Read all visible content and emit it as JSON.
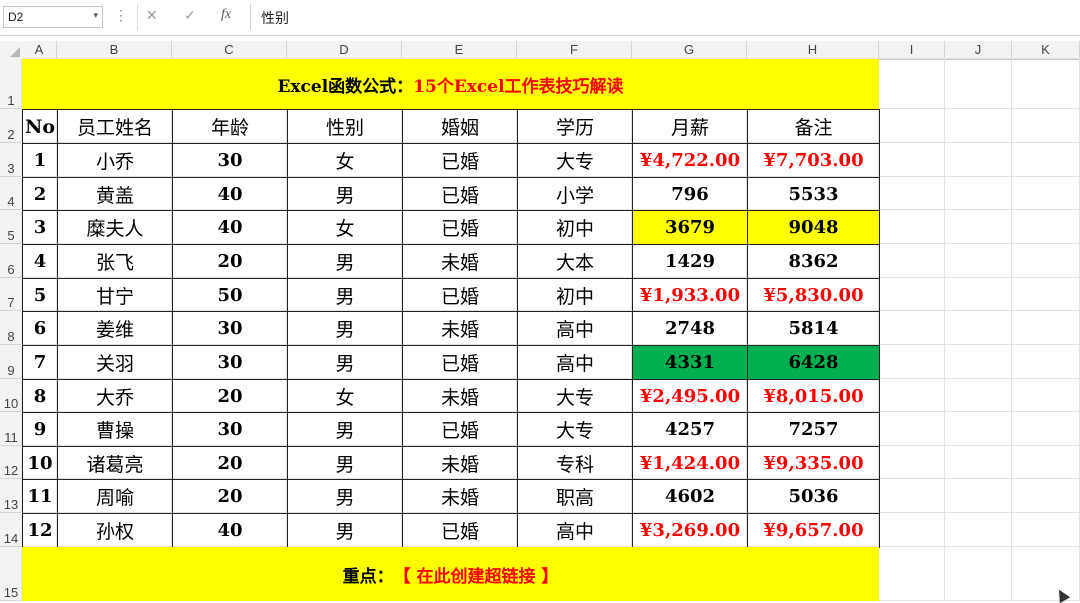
{
  "formula_bar": {
    "name_box": "D2",
    "cancel_icon": "✕",
    "enter_icon": "✓",
    "fx_label": "fx",
    "content": "性别"
  },
  "columns": [
    "A",
    "B",
    "C",
    "D",
    "E",
    "F",
    "G",
    "H",
    "I",
    "J",
    "K"
  ],
  "rows": [
    "1",
    "2",
    "3",
    "4",
    "5",
    "6",
    "7",
    "8",
    "9",
    "10",
    "11",
    "12",
    "13",
    "14",
    "15"
  ],
  "title": {
    "prefix": "Excel函数公式：",
    "text": "15个Excel工作表技巧解读",
    "prefix_color": "#000000",
    "text_color": "#ff0000"
  },
  "table": {
    "headers": [
      "No",
      "员工姓名",
      "年龄",
      "性别",
      "婚姻",
      "学历",
      "月薪",
      "备注"
    ],
    "rows": [
      [
        "1",
        "小乔",
        "30",
        "女",
        "已婚",
        "大专",
        "¥4,722.00",
        "¥7,703.00"
      ],
      [
        "2",
        "黄盖",
        "40",
        "男",
        "已婚",
        "小学",
        "796",
        "5533"
      ],
      [
        "3",
        "糜夫人",
        "40",
        "女",
        "已婚",
        "初中",
        "3679",
        "9048"
      ],
      [
        "4",
        "张飞",
        "20",
        "男",
        "未婚",
        "大本",
        "1429",
        "8362"
      ],
      [
        "5",
        "甘宁",
        "50",
        "男",
        "已婚",
        "初中",
        "¥1,933.00",
        "¥5,830.00"
      ],
      [
        "6",
        "姜维",
        "30",
        "男",
        "未婚",
        "高中",
        "2748",
        "5814"
      ],
      [
        "7",
        "关羽",
        "30",
        "男",
        "已婚",
        "高中",
        "4331",
        "6428"
      ],
      [
        "8",
        "大乔",
        "20",
        "女",
        "未婚",
        "大专",
        "¥2,495.00",
        "¥8,015.00"
      ],
      [
        "9",
        "曹操",
        "30",
        "男",
        "已婚",
        "大专",
        "4257",
        "7257"
      ],
      [
        "10",
        "诸葛亮",
        "20",
        "男",
        "未婚",
        "专科",
        "¥1,424.00",
        "¥9,335.00"
      ],
      [
        "11",
        "周喻",
        "20",
        "男",
        "未婚",
        "职高",
        "4602",
        "5036"
      ],
      [
        "12",
        "孙权",
        "40",
        "男",
        "已婚",
        "高中",
        "¥3,269.00",
        "¥9,657.00"
      ]
    ],
    "red_rows": [
      0,
      4,
      7,
      9,
      11
    ],
    "yellow_rows": [
      2
    ],
    "green_rows": [
      6
    ]
  },
  "footer": {
    "prefix": "重点：",
    "text": "【 在此创建超链接 】"
  },
  "colors": {
    "highlight_yellow": "#ffff00",
    "highlight_green": "#00b050",
    "accent_red": "#ff0000"
  }
}
